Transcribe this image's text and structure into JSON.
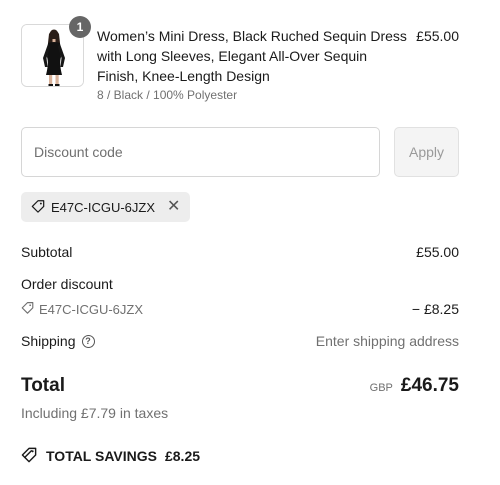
{
  "product": {
    "quantity": "1",
    "title": "Women’s Mini Dress, Black Ruched Sequin Dress with Long Sleeves, Elegant All-Over Sequin Finish, Knee-Length Design",
    "variant": "8 / Black / 100% Polyester",
    "price": "£55.00",
    "image_icon": "black-dress-thumbnail"
  },
  "discount": {
    "placeholder": "Discount code",
    "apply_label": "Apply",
    "applied_code": "E47C-ICGU-6JZX",
    "remove_icon": "close-icon"
  },
  "summary": {
    "subtotal_label": "Subtotal",
    "subtotal_value": "£55.00",
    "order_discount_label": "Order discount",
    "order_discount_code": "E47C-ICGU-6JZX",
    "order_discount_value": "− £8.25",
    "shipping_label": "Shipping",
    "shipping_value": "Enter shipping address",
    "total_label": "Total",
    "currency": "GBP",
    "total_value": "£46.75",
    "taxes_note": "Including £7.79 in taxes",
    "savings_label": "TOTAL SAVINGS",
    "savings_value": "£8.25"
  },
  "colors": {
    "text": "#1a1a1a",
    "muted": "#707070",
    "badge": "#666666",
    "chip_bg": "#ededed",
    "button_bg": "#f4f4f4"
  }
}
